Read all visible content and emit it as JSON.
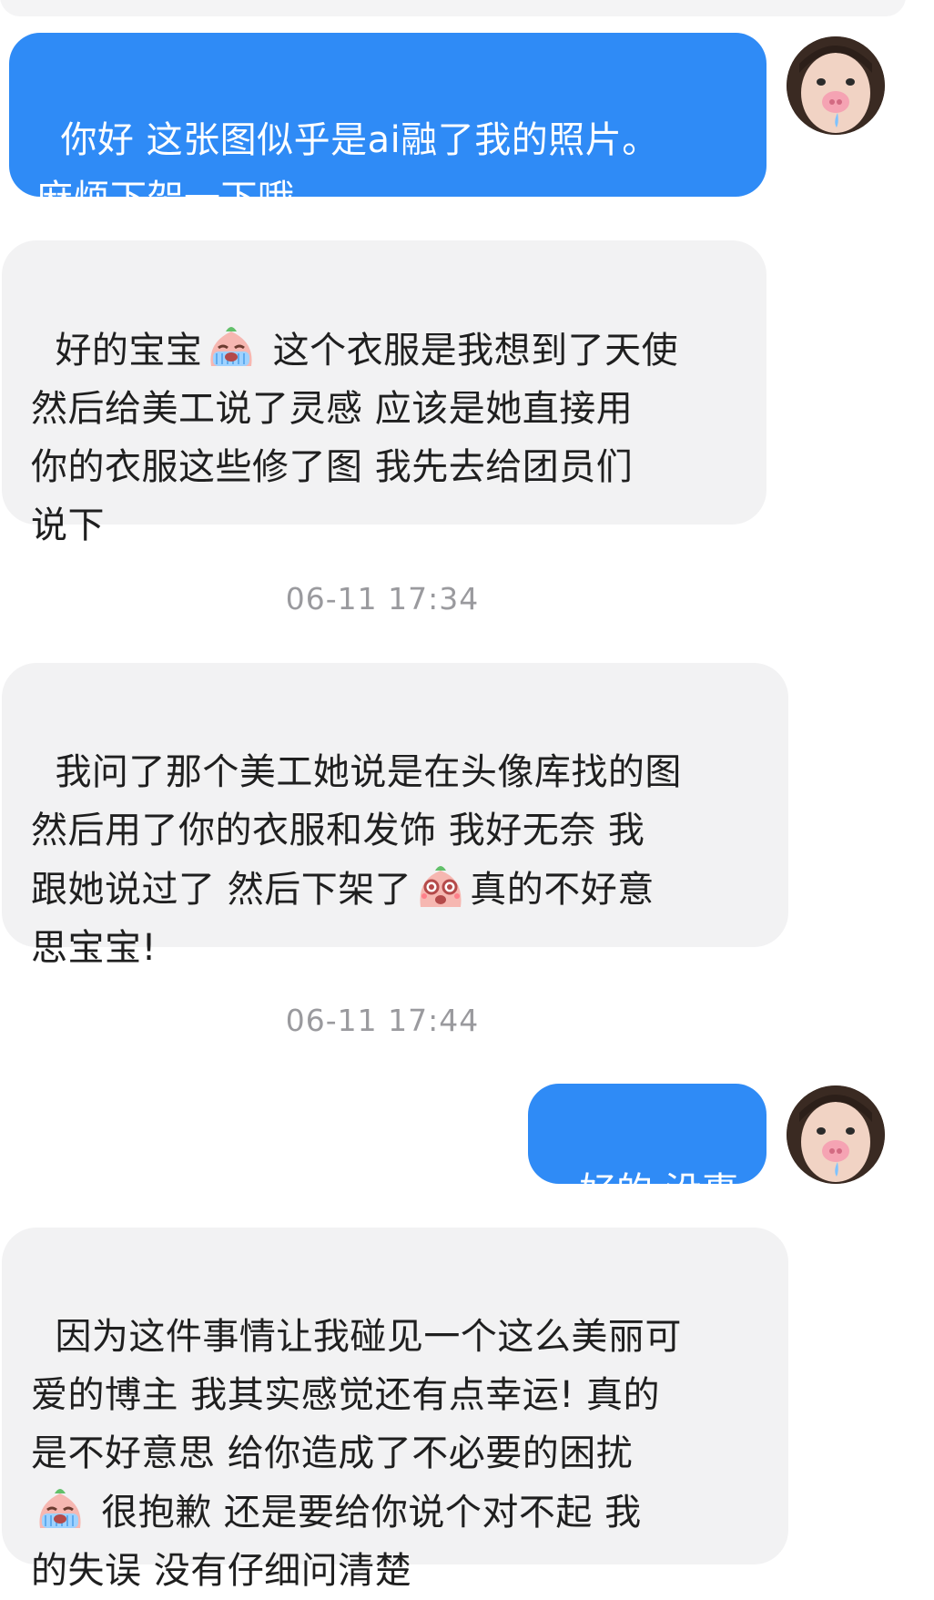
{
  "messages": [
    {
      "id": "m1",
      "side": "outgoing",
      "text": "你好 这张图似乎是ai融了我的照片。\n麻烦下架一下哦"
    },
    {
      "id": "m2",
      "side": "incoming",
      "text_before": "好的宝宝",
      "emoji": "crying-face-emoji",
      "text_after": " 这个衣服是我想到了天使\n然后给美工说了灵感 应该是她直接用\n你的衣服这些修了图 我先去给团员们\n说下"
    },
    {
      "id": "t1",
      "timestamp": "06-11 17:34"
    },
    {
      "id": "m3",
      "side": "incoming",
      "text_before": "我问了那个美工她说是在头像库找的图\n然后用了你的衣服和发饰 我好无奈 我\n跟她说过了 然后下架了",
      "emoji": "teary-face-emoji",
      "text_after": "真的不好意\n思宝宝!"
    },
    {
      "id": "t2",
      "timestamp": "06-11 17:44"
    },
    {
      "id": "m4",
      "side": "outgoing",
      "text": "好的 没事"
    },
    {
      "id": "m5",
      "side": "incoming",
      "text_before": "因为这件事情让我碰见一个这么美丽可\n爱的博主 我其实感觉还有点幸运! 真的\n是不好意思 给你造成了不必要的困扰\n",
      "emoji": "crying-face-emoji",
      "text_after": " 很抱歉 还是要给你说个对不起 我\n的失误 没有仔细问清楚"
    }
  ],
  "colors": {
    "outgoing_bubble": "#2f8bf6",
    "incoming_bubble": "#f2f2f3",
    "timestamp_text": "#9a9a9e"
  },
  "icons": {
    "avatar": "user-avatar-photo",
    "emoji_1": "crying-face-emoji",
    "emoji_2": "teary-face-emoji"
  }
}
